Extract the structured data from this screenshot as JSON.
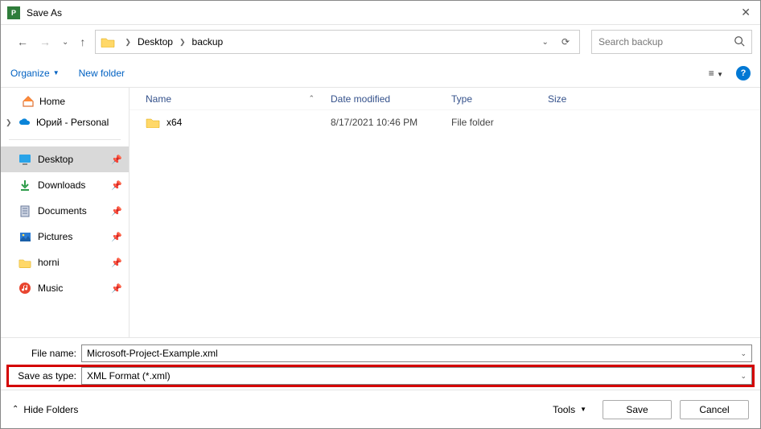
{
  "window": {
    "title": "Save As"
  },
  "breadcrumb": {
    "parts": [
      "Desktop",
      "backup"
    ]
  },
  "search": {
    "placeholder": "Search backup"
  },
  "toolbar": {
    "organize": "Organize",
    "newfolder": "New folder"
  },
  "tree": {
    "home": "Home",
    "onedrive": "Юрий - Personal"
  },
  "quick": [
    {
      "label": "Desktop",
      "selected": true,
      "icon": "desktop"
    },
    {
      "label": "Downloads",
      "selected": false,
      "icon": "downloads"
    },
    {
      "label": "Documents",
      "selected": false,
      "icon": "documents"
    },
    {
      "label": "Pictures",
      "selected": false,
      "icon": "pictures"
    },
    {
      "label": "horni",
      "selected": false,
      "icon": "folder"
    },
    {
      "label": "Music",
      "selected": false,
      "icon": "music"
    }
  ],
  "columns": {
    "name": "Name",
    "date": "Date modified",
    "type": "Type",
    "size": "Size"
  },
  "files": [
    {
      "name": "x64",
      "date": "8/17/2021 10:46 PM",
      "type": "File folder"
    }
  ],
  "form": {
    "filename_label": "File name:",
    "filename_value": "Microsoft-Project-Example.xml",
    "savetype_label": "Save as type:",
    "savetype_value": "XML Format (*.xml)"
  },
  "footer": {
    "hide": "Hide Folders",
    "tools": "Tools",
    "save": "Save",
    "cancel": "Cancel"
  }
}
